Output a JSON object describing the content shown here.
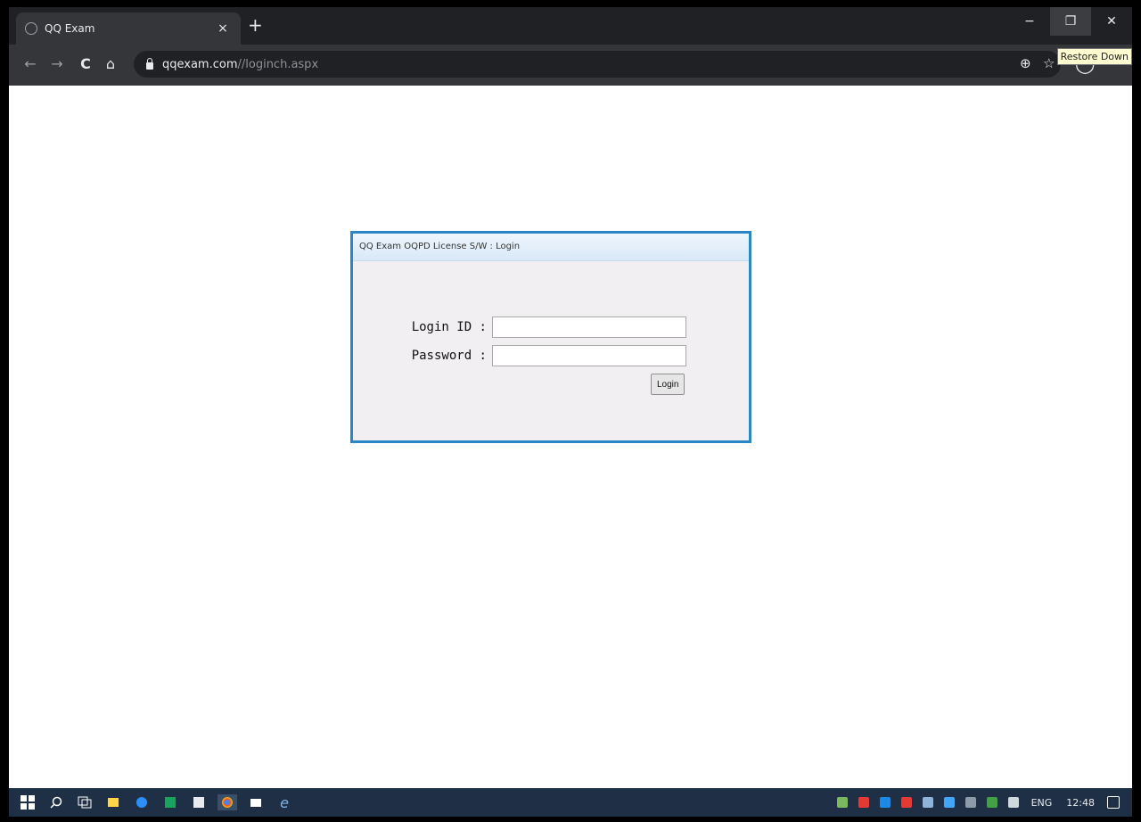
{
  "browser": {
    "tab_title": "QQ Exam",
    "tab_close": "×",
    "new_tab": "+",
    "url_host": "qqexam.com",
    "url_path": "//loginch.aspx",
    "tooltip": "Restore Down",
    "controls": {
      "minimize": "−",
      "restore": "❐",
      "close": "✕"
    },
    "nav": {
      "back": "←",
      "forward": "→",
      "reload": "C",
      "home": "⌂"
    },
    "toolbar_icons": {
      "zoom": "⊕",
      "bookmark": "☆",
      "profile": "◯"
    }
  },
  "dialog": {
    "title": "QQ Exam OQPD License S/W : Login",
    "login_label": "Login ID :",
    "password_label": "Password :",
    "login_value": "",
    "password_value": "",
    "login_button": "Login"
  },
  "taskbar": {
    "language": "ENG",
    "time": "12:48",
    "app_colors": [
      "#0a7bd8",
      "#ffd54a",
      "#2c8ef8",
      "#1aa260",
      "#e8eaed",
      "#ea4335",
      "#ffffff",
      "#7fb3e6"
    ]
  }
}
